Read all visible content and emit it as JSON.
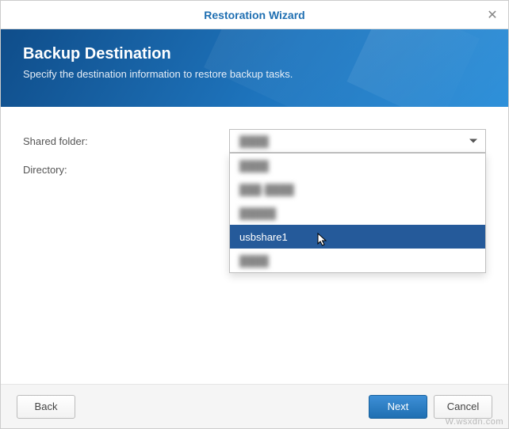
{
  "window": {
    "title": "Restoration Wizard"
  },
  "banner": {
    "heading": "Backup Destination",
    "subheading": "Specify the destination information to restore backup tasks."
  },
  "form": {
    "shared_folder_label": "Shared folder:",
    "directory_label": "Directory:",
    "selected_value": "████",
    "options": [
      {
        "label": "████",
        "blurred": true,
        "highlight": false
      },
      {
        "label": "███-████",
        "blurred": true,
        "highlight": false
      },
      {
        "label": "█████",
        "blurred": true,
        "highlight": false
      },
      {
        "label": "usbshare1",
        "blurred": false,
        "highlight": true
      },
      {
        "label": "████",
        "blurred": true,
        "highlight": false
      }
    ]
  },
  "footer": {
    "back": "Back",
    "next": "Next",
    "cancel": "Cancel"
  },
  "watermark": "W.wsxdn.com"
}
